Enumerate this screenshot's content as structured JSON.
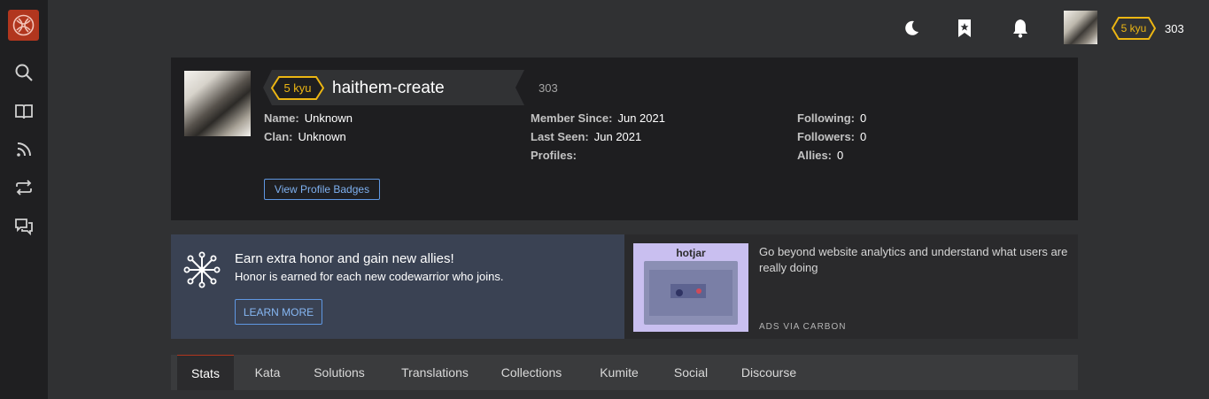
{
  "header": {
    "rank_badge": "5 kyu",
    "honor": "303"
  },
  "icons": {
    "logo": "codewars-logo-icon",
    "search": "search-icon",
    "book": "book-icon",
    "rss": "rss-icon",
    "repeat": "repeat-icon",
    "chat": "chat-icon",
    "moon": "moon-icon",
    "bookmark": "bookmark-star-icon",
    "bell": "bell-icon"
  },
  "profile": {
    "rank_badge": "5 kyu",
    "username": "haithem-create",
    "honor": "303",
    "left_column": [
      {
        "label": "Name:",
        "value": "Unknown"
      },
      {
        "label": "Clan:",
        "value": "Unknown"
      }
    ],
    "middle_column": [
      {
        "label": "Member Since:",
        "value": "Jun 2021"
      },
      {
        "label": "Last Seen:",
        "value": "Jun 2021"
      },
      {
        "label": "Profiles:",
        "value": ""
      }
    ],
    "right_column": [
      {
        "label": "Following:",
        "value": "0"
      },
      {
        "label": "Followers:",
        "value": "0"
      },
      {
        "label": "Allies:",
        "value": "0"
      }
    ],
    "badges_button": "View Profile Badges"
  },
  "invite": {
    "title": "Earn extra honor and gain new allies!",
    "subtitle": "Honor is earned for each new codewarrior who joins.",
    "button": "LEARN MORE"
  },
  "ad": {
    "brand": "hotjar",
    "text": "Go beyond website analytics and understand what users are really doing",
    "via": "ADS VIA CARBON"
  },
  "tabs": [
    {
      "label": "Stats",
      "active": true
    },
    {
      "label": "Kata",
      "active": false
    },
    {
      "label": "Solutions",
      "active": false
    },
    {
      "label": "Translations",
      "active": false
    },
    {
      "label": "Collections",
      "active": false
    },
    {
      "label": "Kumite",
      "active": false
    },
    {
      "label": "Social",
      "active": false
    },
    {
      "label": "Discourse",
      "active": false
    }
  ],
  "colors": {
    "accent": "#b1361e",
    "kyu_yellow": "#ecb613",
    "link_blue": "#5f97e2"
  }
}
